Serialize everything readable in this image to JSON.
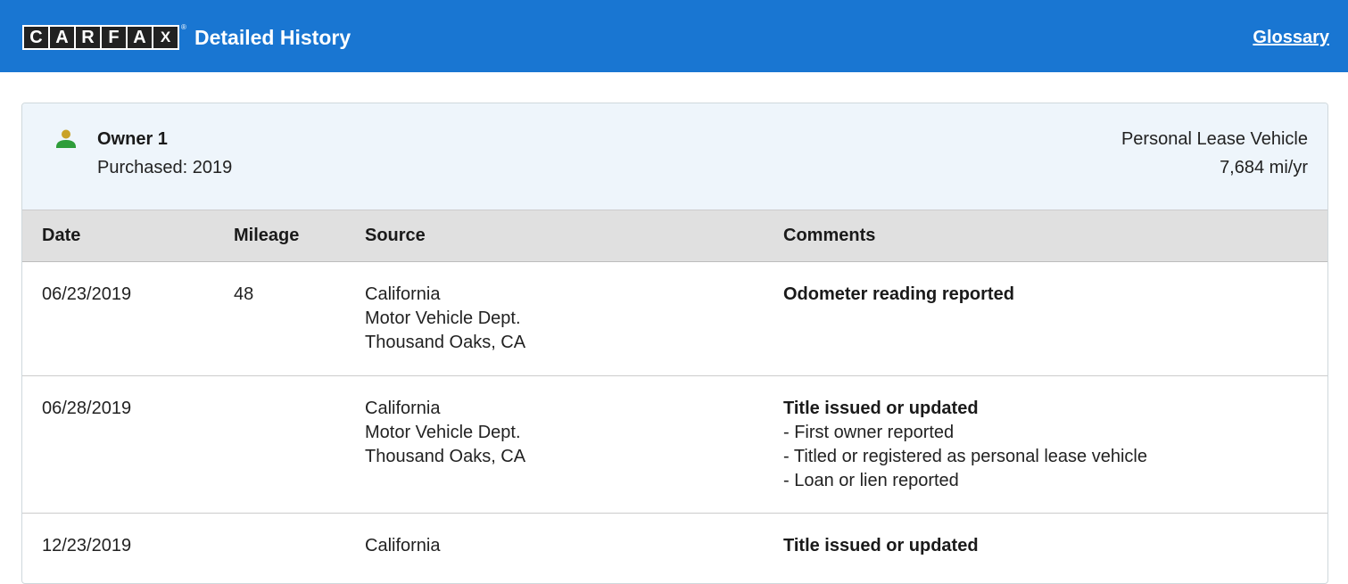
{
  "header": {
    "logo_letters": [
      "C",
      "A",
      "R",
      "F",
      "A",
      "X"
    ],
    "logo_reg": "®",
    "title": "Detailed History",
    "glossary_label": "Glossary",
    "background_color": "#1976d2"
  },
  "owner": {
    "icon": "person-icon",
    "name": "Owner 1",
    "purchased": "Purchased: 2019",
    "vehicle_type": "Personal Lease Vehicle",
    "miles_per_year": "7,684 mi/yr"
  },
  "table": {
    "headers": {
      "date": "Date",
      "mileage": "Mileage",
      "source": "Source",
      "comments": "Comments"
    },
    "rows": [
      {
        "date": "06/23/2019",
        "mileage": "48",
        "source": [
          "California",
          "Motor Vehicle Dept.",
          "Thousand Oaks, CA"
        ],
        "comment_title": "Odometer reading reported",
        "comment_items": []
      },
      {
        "date": "06/28/2019",
        "mileage": "",
        "source": [
          "California",
          "Motor Vehicle Dept.",
          "Thousand Oaks, CA"
        ],
        "comment_title": "Title issued or updated",
        "comment_items": [
          "- First owner reported",
          "- Titled or registered as personal lease vehicle",
          "- Loan or lien reported"
        ]
      },
      {
        "date": "12/23/2019",
        "mileage": "",
        "source": [
          "California"
        ],
        "comment_title": "Title issued or updated",
        "comment_items": []
      }
    ]
  }
}
